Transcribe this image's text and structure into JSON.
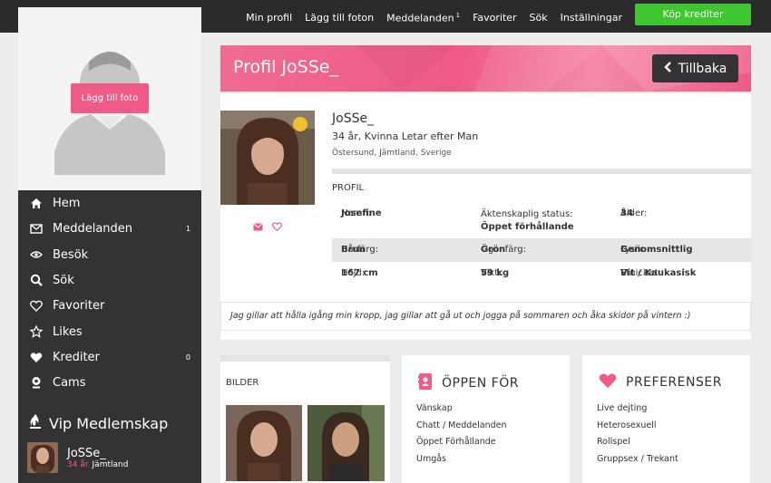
{
  "topnav": {
    "items": [
      "Min profil",
      "Lägg till foton",
      "Meddelanden",
      "Favoriter",
      "Sök",
      "Inställningar"
    ],
    "messages_badge": "1",
    "buy_label": "Köp krediter"
  },
  "sidebar": {
    "add_photo_label": "Lägg till foto",
    "items": [
      {
        "label": "Hem",
        "icon": "home-icon",
        "count": ""
      },
      {
        "label": "Meddelanden",
        "icon": "envelope-icon",
        "count": "1"
      },
      {
        "label": "Besök",
        "icon": "eye-icon",
        "count": ""
      },
      {
        "label": "Sök",
        "icon": "search-icon",
        "count": ""
      },
      {
        "label": "Favoriter",
        "icon": "heart-outline-icon",
        "count": ""
      },
      {
        "label": "Likes",
        "icon": "star-icon",
        "count": ""
      },
      {
        "label": "Krediter",
        "icon": "heart-icon",
        "count": "0"
      },
      {
        "label": "Cams",
        "icon": "webcam-icon",
        "count": ""
      }
    ],
    "vip_label": "Vip Medlemskap",
    "me": {
      "name": "JoSSe_",
      "age": "34 år",
      "region": "Jämtland"
    }
  },
  "header": {
    "title": "Profil JoSSe_",
    "back_label": "Tillbaka"
  },
  "profile": {
    "username": "JoSSe_",
    "summary": "34 år, Kvinna Letar efter Man",
    "location": "Östersund, Jämtland, Sverige",
    "section_title": "PROFIL",
    "fields": {
      "name_label": "Namn:",
      "name_value": "Josefine",
      "marital_label": "Äktenskaplig status:",
      "marital_value": "Öppet förhållande",
      "age_label": "Ålder:",
      "age_value": "34",
      "hair_label": "Hårfärg:",
      "hair_value": "Brun",
      "eye_label": "Ögonfärg:",
      "eye_value": "Grön",
      "body_label": "Fysik:",
      "body_value": "Genomsnittlig",
      "height_label": "Höjd:",
      "height_value": "167 cm",
      "weight_label": "Vikt:",
      "weight_value": "59 kg",
      "ethnicity_label": "Etnicitet:",
      "ethnicity_value": "Vit / Kaukasisk"
    },
    "about": "Jag gillar att hålla igång min kropp, jag gillar att gå ut och jogga på sommaren och åka skidor på vintern :)"
  },
  "pictures": {
    "title": "BILDER"
  },
  "open_for": {
    "title": "ÖPPEN FÖR",
    "items": [
      "Vänskap",
      "Chatt / Meddelanden",
      "Öppet Förhållande",
      "Umgås"
    ]
  },
  "preferences": {
    "title": "PREFERENSER",
    "items": [
      "Live dejting",
      "Heterosexuell",
      "Rollspel",
      "Gruppsex / Trekant"
    ]
  },
  "colors": {
    "accent": "#ef5a86",
    "dark": "#333336",
    "buy": "#3ec72f"
  }
}
